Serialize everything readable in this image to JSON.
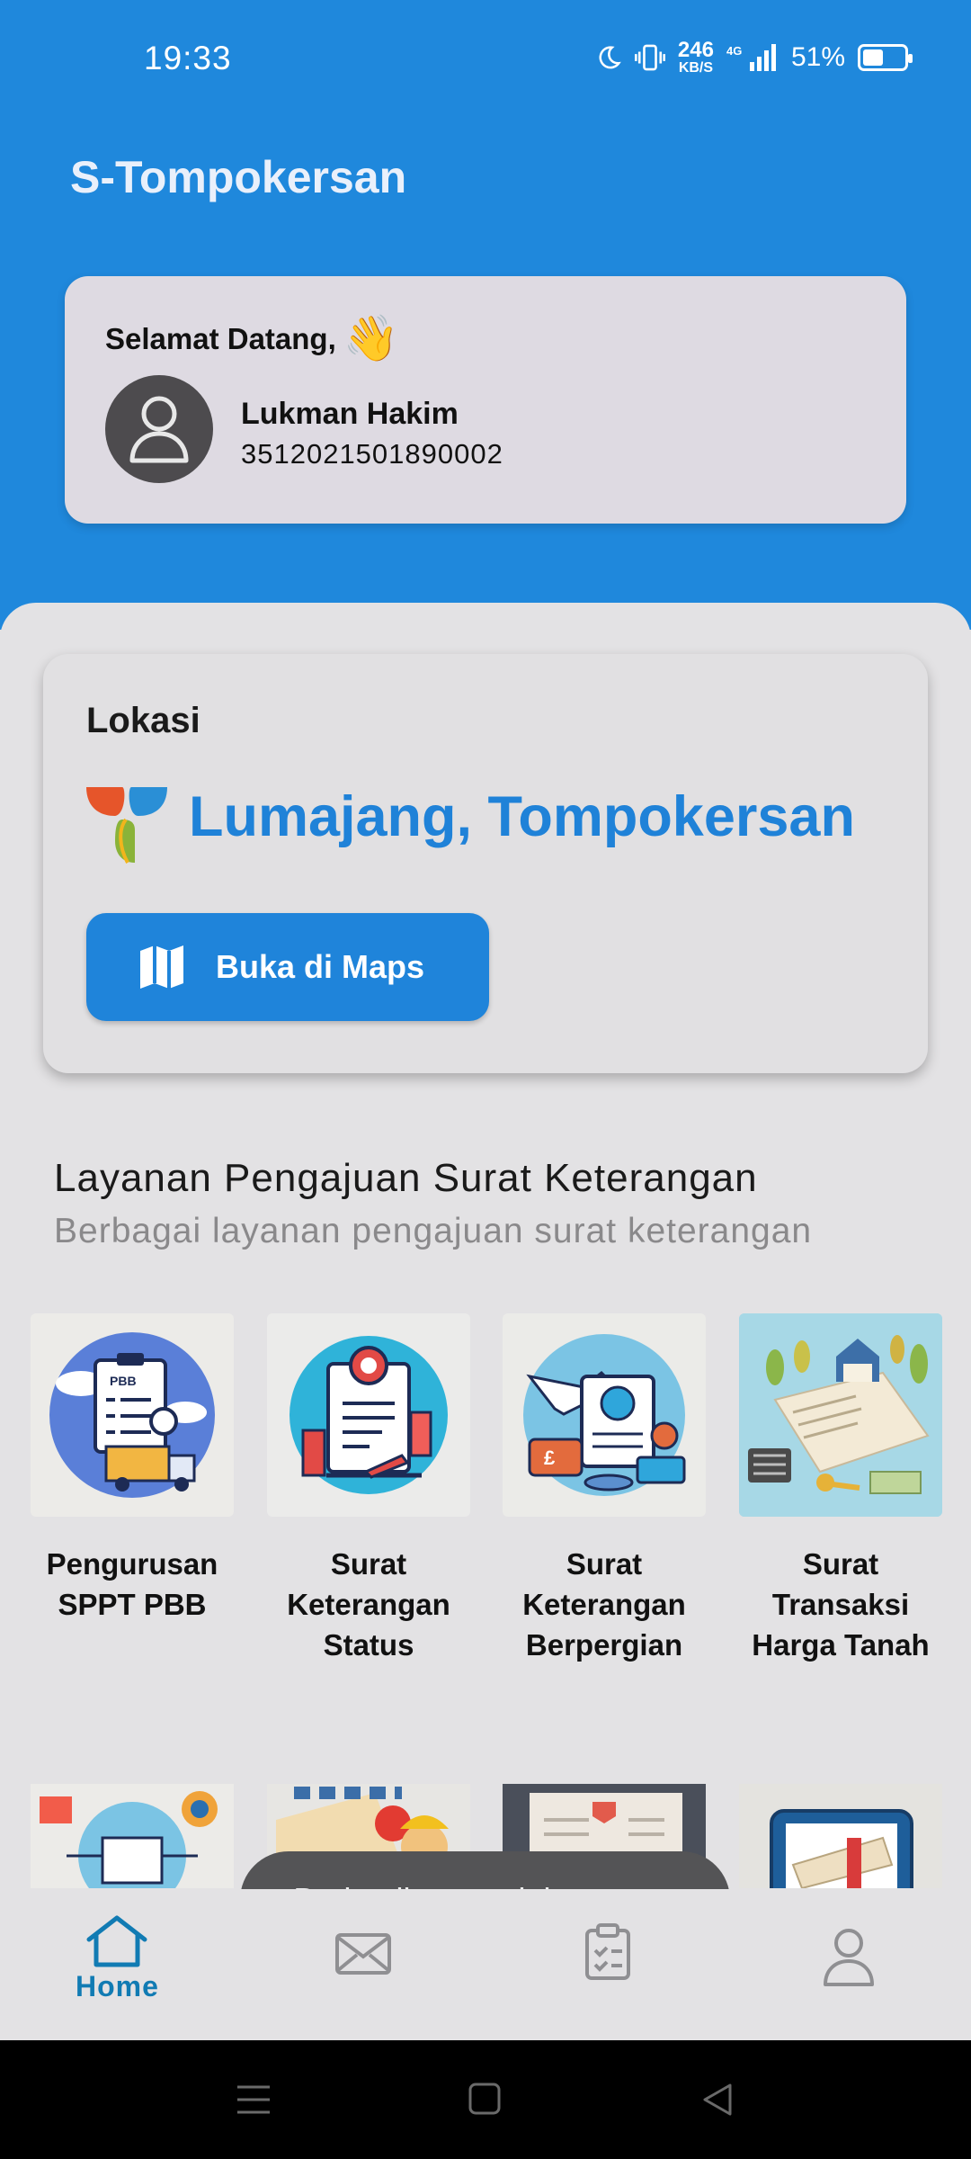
{
  "status_bar": {
    "time": "19:33",
    "speed_value": "246",
    "speed_unit": "KB/S",
    "network": "4G",
    "battery": "51%",
    "battery_level": 0.51
  },
  "app": {
    "title": "S-Tompokersan"
  },
  "welcome": {
    "greeting": "Selamat Datang,",
    "emoji": "👋",
    "name": "Lukman Hakim",
    "nik": "3512021501890002"
  },
  "location": {
    "label": "Lokasi",
    "place": "Lumajang, Tompokersan",
    "maps_button": "Buka di Maps"
  },
  "services_section": {
    "title": "Layanan Pengajuan Surat Keterangan",
    "subtitle": "Berbagai layanan pengajuan surat keterangan",
    "items": [
      {
        "label": "Pengurusan SPPT PBB",
        "icon": "pbb-document-truck-icon"
      },
      {
        "label": "Surat Keterangan Status",
        "icon": "certificate-badge-icon"
      },
      {
        "label": "Surat Keterangan Berpergian",
        "icon": "travel-passport-plane-icon"
      },
      {
        "label": "Surat Transaksi Harga Tanah",
        "icon": "land-deed-house-icon"
      }
    ],
    "more_items": [
      {
        "icon": "certificate-network-icon"
      },
      {
        "icon": "stop-sign-worker-icon"
      },
      {
        "icon": "document-child-icon"
      },
      {
        "icon": "diploma-scroll-icon"
      }
    ]
  },
  "toast": {
    "message": "Berhasil mengajukan surat"
  },
  "bottom_nav": {
    "home_label": "Home",
    "items": [
      "home-icon",
      "mail-icon",
      "clipboard-icon",
      "profile-icon"
    ]
  },
  "colors": {
    "primary": "#1f88dc",
    "accent_text": "#1f82d8",
    "nav_active": "#117bb3",
    "background": "#e3e2e4"
  }
}
